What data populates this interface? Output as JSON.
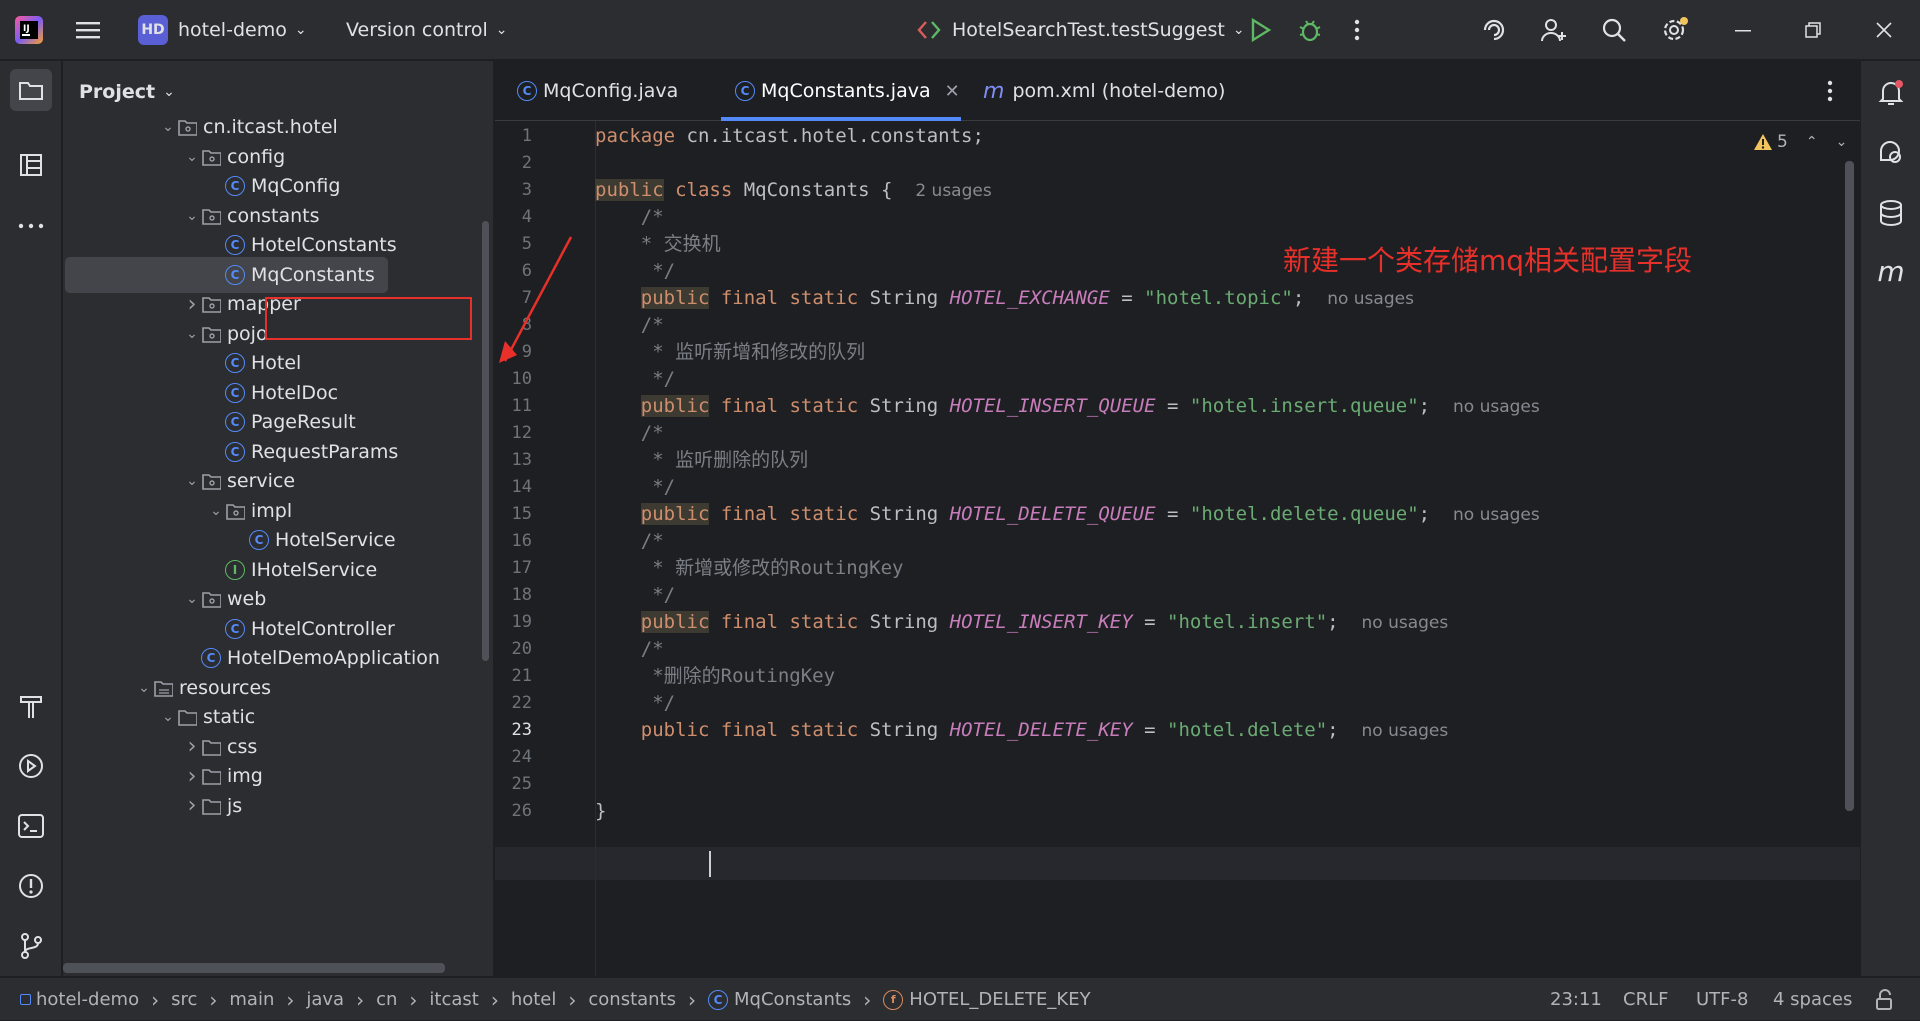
{
  "titlebar": {
    "project_badge": "HD",
    "project_name": "hotel-demo",
    "vcs": "Version control",
    "run_config": "HotelSearchTest.testSuggest"
  },
  "project_panel": {
    "title": "Project",
    "tree": [
      {
        "label": "cn.itcast.hotel",
        "depth": 0,
        "type": "package",
        "chev": "v"
      },
      {
        "label": "config",
        "depth": 1,
        "type": "package",
        "chev": "v"
      },
      {
        "label": "MqConfig",
        "depth": 2,
        "type": "class",
        "chev": ""
      },
      {
        "label": "constants",
        "depth": 1,
        "type": "package",
        "chev": "v"
      },
      {
        "label": "HotelConstants",
        "depth": 2,
        "type": "class",
        "chev": ""
      },
      {
        "label": "MqConstants",
        "depth": 2,
        "type": "class",
        "chev": "",
        "selected": true
      },
      {
        "label": "mapper",
        "depth": 1,
        "type": "package",
        "chev": ">"
      },
      {
        "label": "pojo",
        "depth": 1,
        "type": "package",
        "chev": "v"
      },
      {
        "label": "Hotel",
        "depth": 2,
        "type": "class",
        "chev": ""
      },
      {
        "label": "HotelDoc",
        "depth": 2,
        "type": "class",
        "chev": ""
      },
      {
        "label": "PageResult",
        "depth": 2,
        "type": "class",
        "chev": ""
      },
      {
        "label": "RequestParams",
        "depth": 2,
        "type": "class",
        "chev": ""
      },
      {
        "label": "service",
        "depth": 1,
        "type": "package",
        "chev": "v"
      },
      {
        "label": "impl",
        "depth": 2,
        "type": "package",
        "chev": "v"
      },
      {
        "label": "HotelService",
        "depth": 3,
        "type": "class",
        "chev": ""
      },
      {
        "label": "IHotelService",
        "depth": 2,
        "type": "interface",
        "chev": ""
      },
      {
        "label": "web",
        "depth": 1,
        "type": "package",
        "chev": "v"
      },
      {
        "label": "HotelController",
        "depth": 2,
        "type": "class",
        "chev": ""
      },
      {
        "label": "HotelDemoApplication",
        "depth": 1,
        "type": "app",
        "chev": ""
      },
      {
        "label": "resources",
        "depth": -1,
        "type": "resfolder",
        "chev": "v"
      },
      {
        "label": "static",
        "depth": 0,
        "type": "folder",
        "chev": "v"
      },
      {
        "label": "css",
        "depth": 1,
        "type": "folder",
        "chev": ">"
      },
      {
        "label": "img",
        "depth": 1,
        "type": "folder",
        "chev": ">"
      },
      {
        "label": "js",
        "depth": 1,
        "type": "folder",
        "chev": ">"
      }
    ]
  },
  "tabs": [
    {
      "label": "MqConfig.java",
      "active": false
    },
    {
      "label": "MqConstants.java",
      "active": true
    },
    {
      "label": "pom.xml (hotel-demo)",
      "active": false
    }
  ],
  "editor": {
    "warning_count": "5",
    "current_line": 23,
    "lines": [
      [
        [
          "kw",
          "package"
        ],
        [
          "p",
          " cn.itcast.hotel.constants;"
        ]
      ],
      [],
      [
        [
          "pubhl",
          "public"
        ],
        [
          "p",
          " "
        ],
        [
          "kw",
          "class"
        ],
        [
          "p",
          " MqConstants {  "
        ],
        [
          "hint",
          "2 usages"
        ]
      ],
      [
        [
          "p",
          "    "
        ],
        [
          "cm",
          "/*"
        ]
      ],
      [
        [
          "p",
          "    "
        ],
        [
          "cm",
          "* 交换机"
        ]
      ],
      [
        [
          "p",
          "     "
        ],
        [
          "cm",
          "*/"
        ]
      ],
      [
        [
          "p",
          "    "
        ],
        [
          "pubhl",
          "public"
        ],
        [
          "p",
          " "
        ],
        [
          "kw",
          "final static"
        ],
        [
          "p",
          " String "
        ],
        [
          "const",
          "HOTEL_EXCHANGE"
        ],
        [
          "p",
          " = "
        ],
        [
          "str",
          "\"hotel.topic\""
        ],
        [
          "p",
          ";  "
        ],
        [
          "hint",
          "no usages"
        ]
      ],
      [
        [
          "p",
          "    "
        ],
        [
          "cm",
          "/*"
        ]
      ],
      [
        [
          "p",
          "     "
        ],
        [
          "cm",
          "* 监听新增和修改的队列"
        ]
      ],
      [
        [
          "p",
          "     "
        ],
        [
          "cm",
          "*/"
        ]
      ],
      [
        [
          "p",
          "    "
        ],
        [
          "pubhl",
          "public"
        ],
        [
          "p",
          " "
        ],
        [
          "kw",
          "final static"
        ],
        [
          "p",
          " String "
        ],
        [
          "const",
          "HOTEL_INSERT_QUEUE"
        ],
        [
          "p",
          " = "
        ],
        [
          "str",
          "\"hotel.insert.queue\""
        ],
        [
          "p",
          ";  "
        ],
        [
          "hint",
          "no usages"
        ]
      ],
      [
        [
          "p",
          "    "
        ],
        [
          "cm",
          "/*"
        ]
      ],
      [
        [
          "p",
          "     "
        ],
        [
          "cm",
          "* 监听删除的队列"
        ]
      ],
      [
        [
          "p",
          "     "
        ],
        [
          "cm",
          "*/"
        ]
      ],
      [
        [
          "p",
          "    "
        ],
        [
          "pubhl",
          "public"
        ],
        [
          "p",
          " "
        ],
        [
          "kw",
          "final static"
        ],
        [
          "p",
          " String "
        ],
        [
          "const",
          "HOTEL_DELETE_QUEUE"
        ],
        [
          "p",
          " = "
        ],
        [
          "str",
          "\"hotel.delete.queue\""
        ],
        [
          "p",
          ";  "
        ],
        [
          "hint",
          "no usages"
        ]
      ],
      [
        [
          "p",
          "    "
        ],
        [
          "cm",
          "/*"
        ]
      ],
      [
        [
          "p",
          "     "
        ],
        [
          "cm",
          "* 新增或修改的RoutingKey"
        ]
      ],
      [
        [
          "p",
          "     "
        ],
        [
          "cm",
          "*/"
        ]
      ],
      [
        [
          "p",
          "    "
        ],
        [
          "pubhl",
          "public"
        ],
        [
          "p",
          " "
        ],
        [
          "kw",
          "final static"
        ],
        [
          "p",
          " String "
        ],
        [
          "const",
          "HOTEL_INSERT_KEY"
        ],
        [
          "p",
          " = "
        ],
        [
          "str",
          "\"hotel.insert\""
        ],
        [
          "p",
          ";  "
        ],
        [
          "hint",
          "no usages"
        ]
      ],
      [
        [
          "p",
          "    "
        ],
        [
          "cm",
          "/*"
        ]
      ],
      [
        [
          "p",
          "     "
        ],
        [
          "cm",
          "*删除的RoutingKey"
        ]
      ],
      [
        [
          "p",
          "     "
        ],
        [
          "cm",
          "*/"
        ]
      ],
      [
        [
          "p",
          "    "
        ],
        [
          "kw",
          "public"
        ],
        [
          "p",
          " "
        ],
        [
          "kw",
          "final static"
        ],
        [
          "p",
          " String "
        ],
        [
          "const",
          "HOTEL_DELETE_KEY"
        ],
        [
          "p",
          " = "
        ],
        [
          "str",
          "\"hotel.delete\""
        ],
        [
          "p",
          ";  "
        ],
        [
          "hint",
          "no usages"
        ]
      ],
      [],
      [],
      [
        [
          "p",
          "}"
        ]
      ]
    ]
  },
  "annotation": "新建一个类存储mq相关配置字段",
  "statusbar": {
    "breadcrumbs": [
      "hotel-demo",
      "src",
      "main",
      "java",
      "cn",
      "itcast",
      "hotel",
      "constants",
      "MqConstants",
      "HOTEL_DELETE_KEY"
    ],
    "position": "23:11",
    "line_sep": "CRLF",
    "encoding": "UTF-8",
    "indent": "4 spaces"
  },
  "colors": {
    "accent": "#548af7",
    "annotation": "#e8302a",
    "bg": "#1e1f22",
    "panel": "#2b2d30"
  }
}
